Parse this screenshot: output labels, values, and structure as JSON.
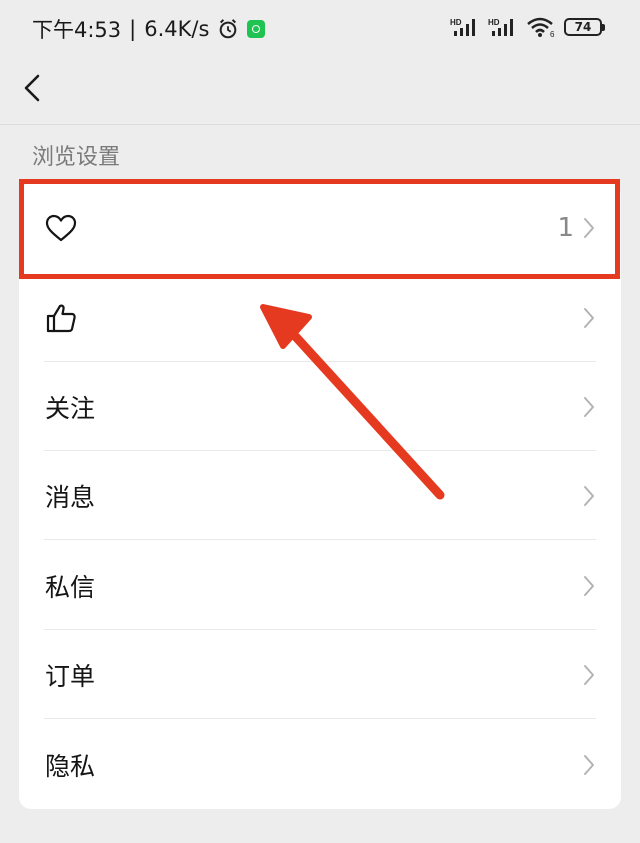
{
  "status_bar": {
    "time": "下午4:53",
    "separator": "|",
    "net_speed": "6.4K/s",
    "battery_level": "74",
    "icons": [
      "alarm-icon",
      "app-notification-icon",
      "signal-hd-icon",
      "signal-hd-icon",
      "wifi-icon",
      "battery-icon"
    ]
  },
  "nav": {
    "back_icon": "back-chevron-icon"
  },
  "section": {
    "title": "浏览设置"
  },
  "rows": [
    {
      "icon": "heart-icon",
      "label": "",
      "count": "1"
    },
    {
      "icon": "thumbs-up-icon",
      "label": ""
    },
    {
      "label": "关注"
    },
    {
      "label": "消息"
    },
    {
      "label": "私信"
    },
    {
      "label": "订单"
    },
    {
      "label": "隐私"
    }
  ],
  "annotation": {
    "highlight_color": "#e63a20"
  }
}
